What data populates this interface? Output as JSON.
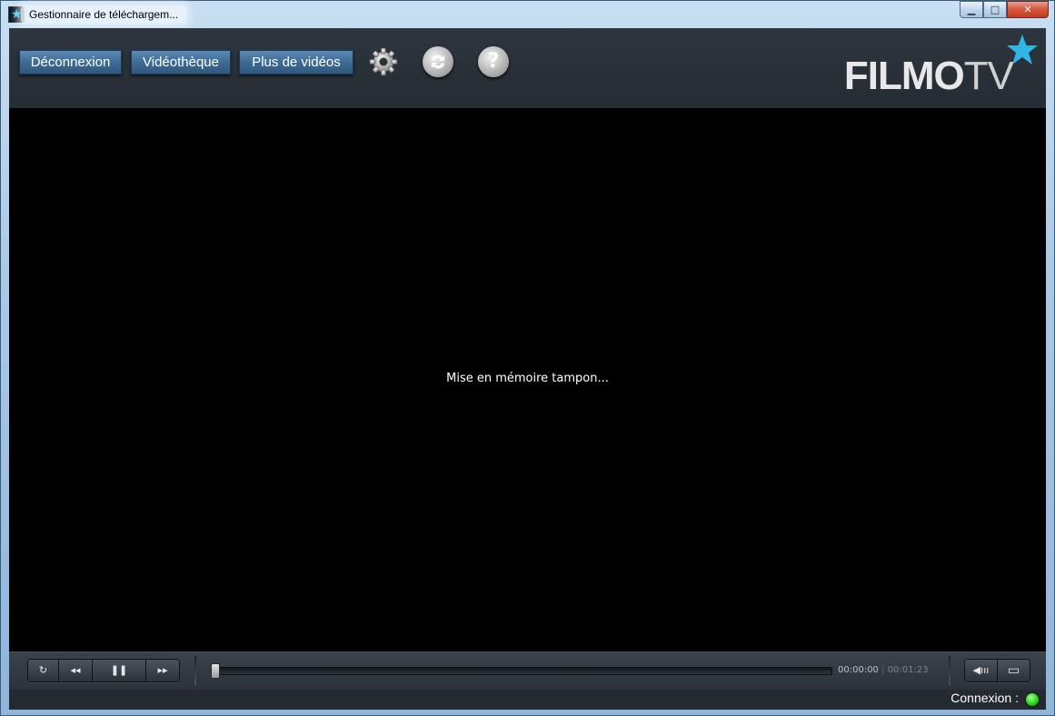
{
  "window": {
    "title": "Gestionnaire de téléchargem...",
    "controls": {
      "minimize": "▁",
      "maximize": "□",
      "close": "✕"
    }
  },
  "header": {
    "buttons": [
      {
        "label": "Déconnexion"
      },
      {
        "label": "Vidéothèque"
      },
      {
        "label": "Plus de vidéos"
      }
    ],
    "icons": [
      "gear-icon",
      "refresh-icon",
      "help-icon"
    ],
    "help_glyph": "?",
    "logo": {
      "bold": "FILMO",
      "light": "TV",
      "accent": "#2fb6e6"
    }
  },
  "video": {
    "status": "Mise en mémoire tampon..."
  },
  "controls": {
    "repeat": "↻",
    "rewind": "◂◂",
    "pause": "❚❚",
    "forward": "▸▸",
    "volume": "◀ııı",
    "fullscreen": "▭",
    "time_current": "00:00:00",
    "time_separator": "|",
    "time_total": "00:01:23",
    "progress": 0
  },
  "status": {
    "connection_label": "Connexion :",
    "connection_color": "#1fcf16"
  }
}
